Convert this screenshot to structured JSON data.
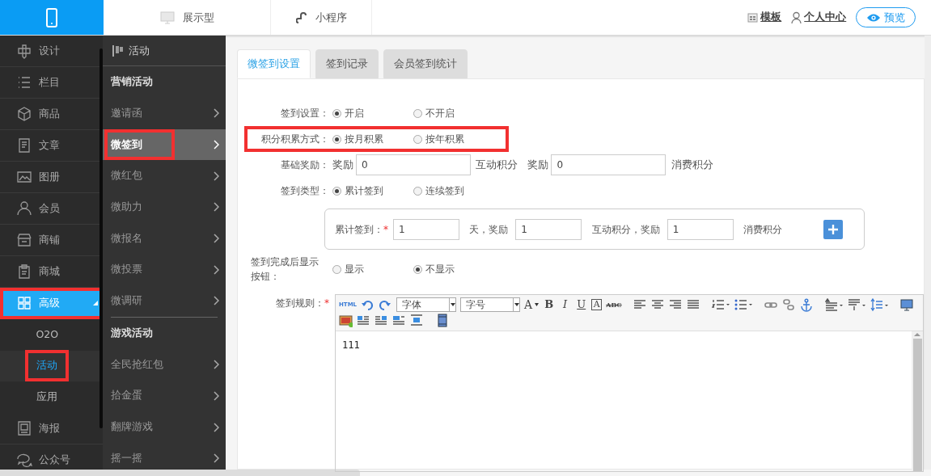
{
  "topbar": {
    "tabs": [
      {
        "label": "展示型",
        "selected": false
      },
      {
        "label": "小程序",
        "selected": false
      }
    ],
    "links": [
      "模板",
      "个人中心"
    ],
    "preview_button": "预览"
  },
  "sidebar": {
    "items": [
      {
        "label": "设计",
        "selected": false,
        "highlighted": false
      },
      {
        "label": "栏目",
        "selected": false,
        "highlighted": false
      },
      {
        "label": "商品",
        "selected": false,
        "highlighted": false
      },
      {
        "label": "文章",
        "selected": false,
        "highlighted": false
      },
      {
        "label": "图册",
        "selected": false,
        "highlighted": false
      },
      {
        "label": "会员",
        "selected": false,
        "highlighted": false
      },
      {
        "label": "商铺",
        "selected": false,
        "highlighted": false
      },
      {
        "label": "商城",
        "selected": false,
        "highlighted": false
      },
      {
        "label": "高级",
        "selected": true,
        "highlighted": true,
        "expanded": true,
        "children": [
          {
            "label": "O2O",
            "selected": false,
            "highlighted": false
          },
          {
            "label": "活动",
            "selected": true,
            "highlighted": true
          },
          {
            "label": "应用",
            "selected": false,
            "highlighted": false
          }
        ]
      },
      {
        "label": "海报",
        "selected": false,
        "highlighted": false
      },
      {
        "label": "公众号",
        "selected": false,
        "highlighted": false
      }
    ]
  },
  "submenu": {
    "title": "活动",
    "groups": [
      {
        "title": "营销活动",
        "items": [
          {
            "label": "邀请函",
            "selected": false,
            "highlighted": false
          },
          {
            "label": "微签到",
            "selected": true,
            "highlighted": true
          },
          {
            "label": "微红包",
            "selected": false,
            "highlighted": false
          },
          {
            "label": "微助力",
            "selected": false,
            "highlighted": false
          },
          {
            "label": "微报名",
            "selected": false,
            "highlighted": false
          },
          {
            "label": "微投票",
            "selected": false,
            "highlighted": false
          },
          {
            "label": "微调研",
            "selected": false,
            "highlighted": false
          }
        ]
      },
      {
        "title": "游戏活动",
        "items": [
          {
            "label": "全民抢红包",
            "selected": false,
            "highlighted": false
          },
          {
            "label": "拾金蛋",
            "selected": false,
            "highlighted": false
          },
          {
            "label": "翻牌游戏",
            "selected": false,
            "highlighted": false
          },
          {
            "label": "摇一摇",
            "selected": false,
            "highlighted": false
          }
        ]
      }
    ]
  },
  "tabs": [
    {
      "label": "微签到设置",
      "selected": true
    },
    {
      "label": "签到记录",
      "selected": false
    },
    {
      "label": "会员签到统计",
      "selected": false
    }
  ],
  "form": {
    "rows": [
      {
        "kind": "radio",
        "label": "签到设置：",
        "highlighted": false,
        "options": [
          {
            "label": "开启",
            "selected": true
          },
          {
            "label": "不开启",
            "selected": false
          }
        ]
      },
      {
        "kind": "radio",
        "label": "积分积累方式：",
        "highlighted": true,
        "options": [
          {
            "label": "按月积累",
            "selected": true
          },
          {
            "label": "按年积累",
            "selected": false
          }
        ]
      },
      {
        "kind": "inputs",
        "label": "基础奖励：",
        "parts": [
          {
            "before": "奖励",
            "value": "0",
            "after": "互动积分"
          },
          {
            "before": "奖励",
            "value": "0",
            "after": "消费积分"
          }
        ]
      },
      {
        "kind": "radio",
        "label": "签到类型：",
        "highlighted": false,
        "options": [
          {
            "label": "累计签到",
            "selected": true
          },
          {
            "label": "连续签到",
            "selected": false
          }
        ]
      },
      {
        "kind": "group",
        "label_before": "累计签到：",
        "required_mark": "*",
        "parts": [
          {
            "value": "1",
            "after": "天，奖励"
          },
          {
            "value": "1",
            "after": "互动积分，奖励"
          },
          {
            "value": "1",
            "after": "消费积分"
          }
        ]
      },
      {
        "kind": "radio",
        "label": "签到完成后显示按钮：",
        "highlighted": false,
        "options": [
          {
            "label": "显示",
            "selected": false
          },
          {
            "label": "不显示",
            "selected": true
          }
        ]
      },
      {
        "kind": "editor",
        "label": "签到规则：",
        "required_mark": "*",
        "content": "111",
        "toolbar": [
          [
            {
              "kind": "html",
              "text": "HTML"
            },
            {
              "kind": "undo"
            },
            {
              "kind": "redo"
            },
            {
              "kind": "select",
              "text": "字体"
            },
            {
              "kind": "select",
              "text": "字号"
            },
            {
              "kind": "color",
              "text": "A"
            },
            {
              "kind": "bold",
              "text": "B"
            },
            {
              "kind": "italic",
              "text": "I"
            },
            {
              "kind": "underline",
              "text": "U"
            },
            {
              "kind": "boxed",
              "text": "A"
            },
            {
              "kind": "strike",
              "text": "ABC"
            },
            {
              "kind": "sep"
            },
            {
              "kind": "alignleft"
            },
            {
              "kind": "aligncenter"
            },
            {
              "kind": "alignright"
            },
            {
              "kind": "justify"
            },
            {
              "kind": "sep"
            },
            {
              "kind": "ol"
            },
            {
              "kind": "ul"
            },
            {
              "kind": "sep"
            },
            {
              "kind": "link"
            },
            {
              "kind": "unlink"
            },
            {
              "kind": "anchor"
            },
            {
              "kind": "sep"
            },
            {
              "kind": "spacetop"
            },
            {
              "kind": "spacebottom"
            },
            {
              "kind": "lineheight"
            },
            {
              "kind": "sep"
            },
            {
              "kind": "preview"
            }
          ],
          [
            {
              "kind": "image"
            },
            {
              "kind": "floatleft"
            },
            {
              "kind": "floatright"
            },
            {
              "kind": "floatnone"
            },
            {
              "kind": "center"
            },
            {
              "kind": "video"
            }
          ]
        ]
      }
    ]
  }
}
